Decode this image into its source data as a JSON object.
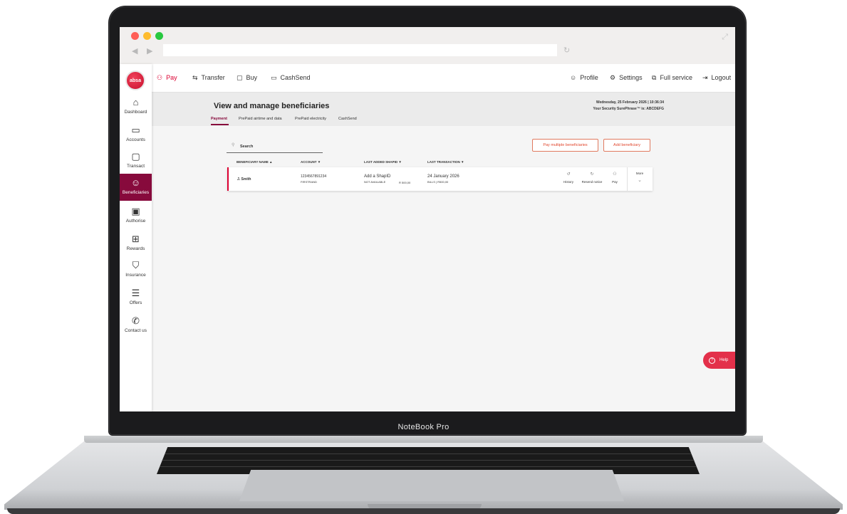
{
  "device": {
    "label": "NoteBook Pro"
  },
  "browser": {
    "back_glyph": "◀",
    "forward_glyph": "▶",
    "reload_glyph": "↻",
    "expand_glyph": "⤢"
  },
  "brand": {
    "logo_text": "absa",
    "color": "#dc0032",
    "accent": "#870a3c"
  },
  "sidebar": {
    "items": [
      {
        "label": "Dashboard",
        "icon": "home-icon",
        "glyph": "⌂"
      },
      {
        "label": "Accounts",
        "icon": "card-icon",
        "glyph": "▭"
      },
      {
        "label": "Transact",
        "icon": "transact-icon",
        "glyph": "▢"
      },
      {
        "label": "Beneficiaries",
        "icon": "people-icon",
        "glyph": "☺"
      },
      {
        "label": "Authorise",
        "icon": "authorise-icon",
        "glyph": "▣"
      },
      {
        "label": "Rewards",
        "icon": "gift-icon",
        "glyph": "⊞"
      },
      {
        "label": "Insurance",
        "icon": "shield-icon",
        "glyph": "⛉"
      },
      {
        "label": "Offers",
        "icon": "document-icon",
        "glyph": "☰"
      },
      {
        "label": "Contact us",
        "icon": "phone-icon",
        "glyph": "✆"
      }
    ],
    "active": "Beneficiaries"
  },
  "topnav": {
    "pay": {
      "label": "Pay",
      "glyph": "⚇"
    },
    "transfer": {
      "label": "Transfer",
      "glyph": "⇆"
    },
    "buy": {
      "label": "Buy",
      "glyph": "▢"
    },
    "cashsend": {
      "label": "CashSend",
      "glyph": "▭"
    },
    "profile": {
      "label": "Profile",
      "glyph": "☺"
    },
    "settings": {
      "label": "Settings",
      "glyph": "⚙"
    },
    "full_service": {
      "label": "Full service",
      "glyph": "⧉"
    },
    "logout": {
      "label": "Logout",
      "glyph": "⇥"
    }
  },
  "header": {
    "title": "View and manage beneficiaries",
    "tabs": [
      "Payment",
      "PrePaid airtime and data",
      "PrePaid electricity",
      "CashSend"
    ],
    "active_tab": "Payment",
    "datetime": "Wednesday, 25 February 2026 | 10:36:34",
    "surephrase": "Your Security SurePhrase™ is: ABCDEFG"
  },
  "search": {
    "label": "Search",
    "glyph": "⚲"
  },
  "buttons": {
    "pay_multiple": "Pay multiple beneficiaries",
    "add": "Add beneficiary"
  },
  "table": {
    "headers": {
      "name": "BENEFICIARY NAME ▲",
      "account": "ACCOUNT ▼",
      "last_added": "LAST ADDED SHAPID ▼",
      "last_transaction": "LAST TRANSACTION ▼"
    },
    "rows": [
      {
        "name": "J. Smith",
        "account_number": "1234567891234",
        "bank": "FIRSTRAND",
        "shapid_line1": "Add a ShapID",
        "shapid_line2": "NOT AVAILABLE",
        "amount": "R 500,00",
        "txn_date": "24 January 2026",
        "txn_detail": "BILLS | R500,00",
        "actions": [
          {
            "label": "History",
            "glyph": "↺"
          },
          {
            "label": "Resend notice",
            "glyph": "↻"
          },
          {
            "label": "Pay",
            "glyph": "⚇"
          }
        ],
        "more_label": "More",
        "more_glyph": "⌄"
      }
    ]
  },
  "help": {
    "label": "Help",
    "glyph": "?"
  }
}
